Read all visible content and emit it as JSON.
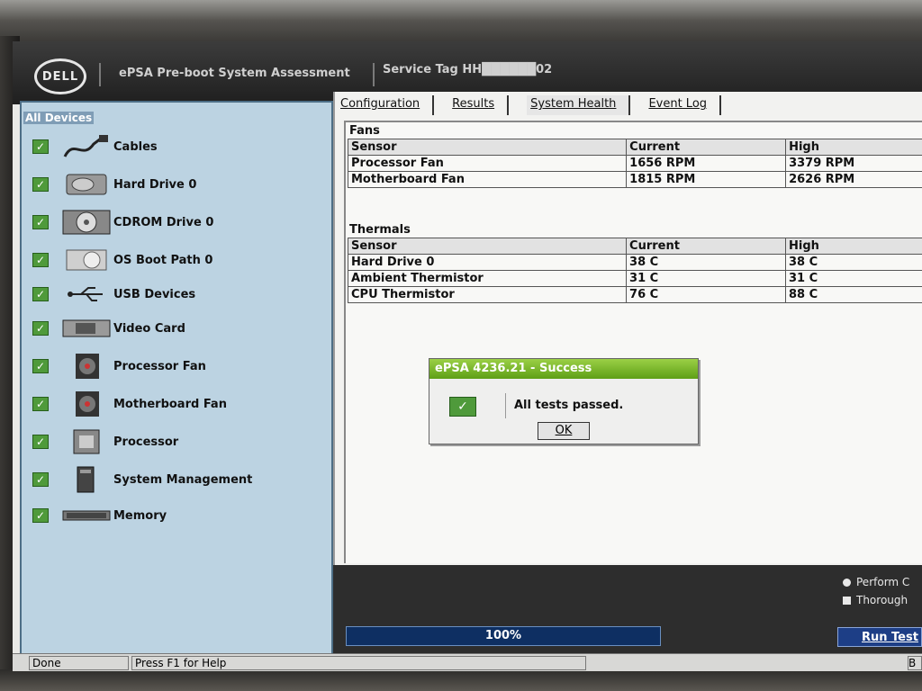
{
  "header": {
    "logo": "DELL",
    "title": "ePSA Pre-boot System Assessment",
    "service_tag": "Service Tag HH██████02"
  },
  "sidebar": {
    "heading": "All Devices",
    "items": [
      {
        "label": "Cables",
        "icon": "cable-icon"
      },
      {
        "label": "Hard Drive 0",
        "icon": "hard-drive-icon"
      },
      {
        "label": "CDROM Drive 0",
        "icon": "cdrom-icon"
      },
      {
        "label": "OS Boot Path 0",
        "icon": "boot-path-icon"
      },
      {
        "label": "USB Devices",
        "icon": "usb-icon"
      },
      {
        "label": "Video Card",
        "icon": "video-card-icon"
      },
      {
        "label": "Processor Fan",
        "icon": "fan-icon"
      },
      {
        "label": "Motherboard Fan",
        "icon": "fan-icon"
      },
      {
        "label": "Processor",
        "icon": "processor-icon"
      },
      {
        "label": "System Management",
        "icon": "system-management-icon"
      },
      {
        "label": "Memory",
        "icon": "memory-icon"
      }
    ]
  },
  "tabs": [
    "Configuration",
    "Results",
    "System Health",
    "Event Log"
  ],
  "fans": {
    "label": "Fans",
    "headers": [
      "Sensor",
      "Current",
      "High"
    ],
    "rows": [
      [
        "Processor Fan",
        "1656 RPM",
        "3379 RPM"
      ],
      [
        "Motherboard Fan",
        "1815 RPM",
        "2626 RPM"
      ]
    ]
  },
  "thermals": {
    "label": "Thermals",
    "headers": [
      "Sensor",
      "Current",
      "High"
    ],
    "rows": [
      [
        "Hard Drive 0",
        "38 C",
        "38 C"
      ],
      [
        "Ambient Thermistor",
        "31 C",
        "31 C"
      ],
      [
        "CPU Thermistor",
        "76 C",
        "88 C"
      ]
    ]
  },
  "dialog": {
    "title": "ePSA 4236.21 - Success",
    "message": "All tests passed.",
    "ok_label": "OK"
  },
  "progress": {
    "text": "100%",
    "value": 1.0
  },
  "options": {
    "perform": "Perform C",
    "thorough": "Thorough"
  },
  "run_button": "Run Test",
  "status": {
    "state": "Done",
    "help": "Press F1 for Help",
    "extra": "B"
  }
}
